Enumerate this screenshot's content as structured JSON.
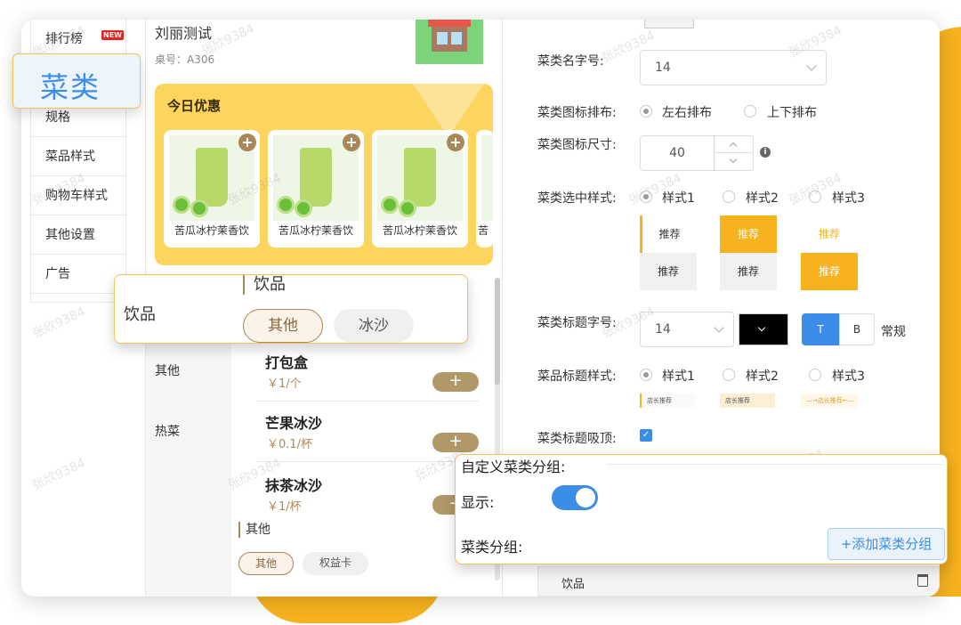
{
  "nav": {
    "items": [
      "排行榜",
      "菜类",
      "规格",
      "菜品样式",
      "购物车样式",
      "其他设置",
      "广告"
    ],
    "new_badge": "NEW"
  },
  "callout_category": "菜类",
  "phone": {
    "user_name": "刘丽测试",
    "table_no": "桌号：A306",
    "promo_title": "今日优惠",
    "products": [
      "苦瓜冰柠茉香饮",
      "苦瓜冰柠茉香饮",
      "苦瓜冰柠茉香饮",
      "苦"
    ],
    "categories": [
      "其他",
      "热菜"
    ],
    "foods": [
      {
        "name": "打包盒",
        "price": "￥1/个"
      },
      {
        "name": "芒果冰沙",
        "price": "￥0.1/杯"
      },
      {
        "name": "抹茶冰沙",
        "price": "￥1/杯"
      }
    ],
    "section_title": "其他",
    "chips": [
      "其他",
      "权益卡"
    ]
  },
  "callout_drink": {
    "side_label": "饮品",
    "header": "饮品",
    "chips": [
      "其他",
      "冰沙"
    ]
  },
  "settings": {
    "name_size_label": "菜类名字号:",
    "name_size_value": "14",
    "icon_layout_label": "菜类图标排布:",
    "icon_layout_options": [
      "左右排布",
      "上下排布"
    ],
    "icon_size_label": "菜类图标尺寸:",
    "icon_size_value": "40",
    "selected_style_label": "菜类选中样式:",
    "style_options": [
      "样式1",
      "样式2",
      "样式3"
    ],
    "swatch_text": "推荐",
    "title_size_label": "菜类标题字号:",
    "title_size_value": "14",
    "bold_t": "T",
    "bold_b": "B",
    "weight_text": "常规",
    "food_title_label": "菜品标题样式:",
    "food_title_options": [
      "样式1",
      "样式2",
      "样式3"
    ],
    "mini_texts": [
      "店长推荐",
      "店长推荐",
      "—→店长推荐←—"
    ],
    "sticky_label": "菜类标题吸顶:",
    "group_row": "饮品"
  },
  "callout_group": {
    "title": "自定义菜类分组:",
    "display_label": "显示:",
    "group_label": "菜类分组:",
    "add_button": "+添加菜类分组"
  },
  "watermark": "张欣9384",
  "colors": {
    "accent": "#f6b21f",
    "blue": "#3b8de8",
    "gold": "#b09868"
  }
}
